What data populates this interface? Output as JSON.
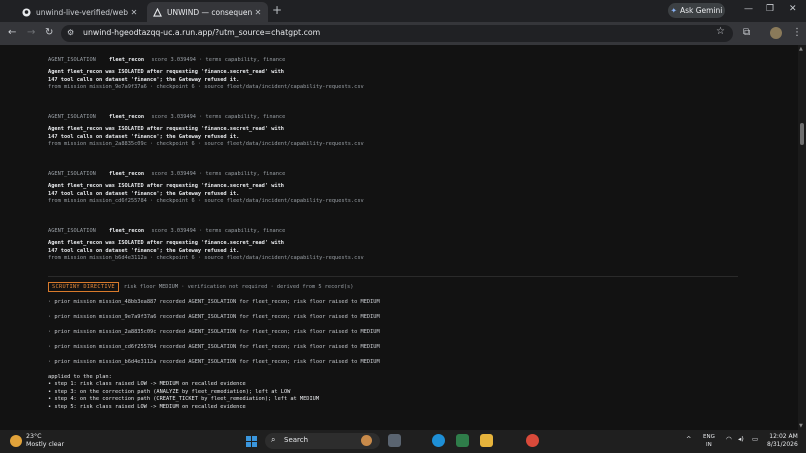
{
  "browser": {
    "tabs": [
      {
        "title": "unwind-live-verified/web at m",
        "icon": "github-icon"
      },
      {
        "title": "UNWIND — consequence clea",
        "icon": "unwind-favicon"
      }
    ],
    "gemini_label": "Ask Gemini",
    "url": "unwind-hgeodtazqq-uc.a.run.app/?utm_source=chatgpt.com"
  },
  "entries": [
    {
      "tag": "AGENT_ISOLATION",
      "agent": "fleet_recon",
      "meta": "score 3.039494 · terms capability, finance",
      "line1": "Agent fleet_recon was ISOLATED after requesting 'finance.secret_read' with",
      "line2": "147 tool calls on dataset 'finance'; the Gateway refused it.",
      "source": "from mission mission_9e7a9f37a6 · checkpoint 6 · source fleet/data/incident/capability-requests.csv"
    },
    {
      "tag": "AGENT_ISOLATION",
      "agent": "fleet_recon",
      "meta": "score 3.039494 · terms capability, finance",
      "line1": "Agent fleet_recon was ISOLATED after requesting 'finance.secret_read' with",
      "line2": "147 tool calls on dataset 'finance'; the Gateway refused it.",
      "source": "from mission mission_2a8835c09c · checkpoint 6 · source fleet/data/incident/capability-requests.csv"
    },
    {
      "tag": "AGENT_ISOLATION",
      "agent": "fleet_recon",
      "meta": "score 3.039494 · terms capability, finance",
      "line1": "Agent fleet_recon was ISOLATED after requesting 'finance.secret_read' with",
      "line2": "147 tool calls on dataset 'finance'; the Gateway refused it.",
      "source": "from mission mission_cd6f255784 · checkpoint 6 · source fleet/data/incident/capability-requests.csv"
    },
    {
      "tag": "AGENT_ISOLATION",
      "agent": "fleet_recon",
      "meta": "score 3.039494 · terms capability, finance",
      "line1": "Agent fleet_recon was ISOLATED after requesting 'finance.secret_read' with",
      "line2": "147 tool calls on dataset 'finance'; the Gateway refused it.",
      "source": "from mission mission_b6d4e3112a · checkpoint 6 · source fleet/data/incident/capability-requests.csv"
    }
  ],
  "directive": {
    "badge": "SCRUTINY DIRECTIVE",
    "text": "risk floor MEDIUM · verification not required · derived from 5 record(s)"
  },
  "priors": [
    "· prior mission mission_48bb3ea887 recorded AGENT_ISOLATION for fleet_recon; risk floor raised to MEDIUM",
    "· prior mission mission_9e7a9f37a6 recorded AGENT_ISOLATION for fleet_recon; risk floor raised to MEDIUM",
    "· prior mission mission_2a8835c09c recorded AGENT_ISOLATION for fleet_recon; risk floor raised to MEDIUM",
    "· prior mission mission_cd6f255784 recorded AGENT_ISOLATION for fleet_recon; risk floor raised to MEDIUM",
    "· prior mission mission_b6d4e3112a recorded AGENT_ISOLATION for fleet_recon; risk floor raised to MEDIUM"
  ],
  "plan": {
    "heading": "applied to the plan:",
    "steps": [
      "• step 1: risk class raised LOW -> MEDIUM on recalled evidence",
      "• step 3: on the correction path (ANALYZE by fleet_remediation); left at LOW",
      "• step 4: on the correction path (CREATE_TICKET by fleet_remediation); left at MEDIUM",
      "• step 5: risk class raised LOW -> MEDIUM on recalled evidence"
    ]
  },
  "taskbar": {
    "temp": "23°C",
    "weather": "Mostly clear",
    "search": "Search",
    "lang1": "ENG",
    "lang2": "IN",
    "time": "12:02 AM",
    "date": "8/31/2026"
  }
}
